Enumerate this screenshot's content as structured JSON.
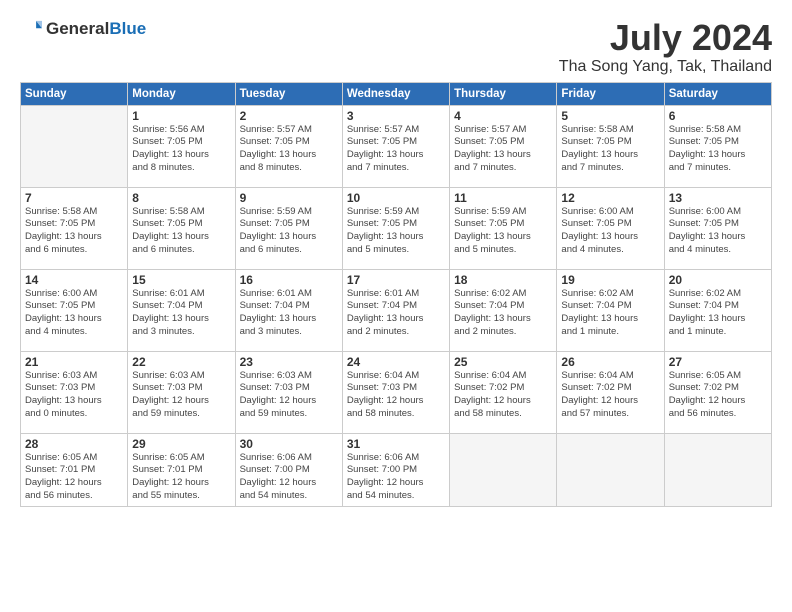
{
  "header": {
    "logo_general": "General",
    "logo_blue": "Blue",
    "month": "July 2024",
    "location": "Tha Song Yang, Tak, Thailand"
  },
  "weekdays": [
    "Sunday",
    "Monday",
    "Tuesday",
    "Wednesday",
    "Thursday",
    "Friday",
    "Saturday"
  ],
  "weeks": [
    [
      {
        "day": "",
        "info": ""
      },
      {
        "day": "1",
        "info": "Sunrise: 5:56 AM\nSunset: 7:05 PM\nDaylight: 13 hours\nand 8 minutes."
      },
      {
        "day": "2",
        "info": "Sunrise: 5:57 AM\nSunset: 7:05 PM\nDaylight: 13 hours\nand 8 minutes."
      },
      {
        "day": "3",
        "info": "Sunrise: 5:57 AM\nSunset: 7:05 PM\nDaylight: 13 hours\nand 7 minutes."
      },
      {
        "day": "4",
        "info": "Sunrise: 5:57 AM\nSunset: 7:05 PM\nDaylight: 13 hours\nand 7 minutes."
      },
      {
        "day": "5",
        "info": "Sunrise: 5:58 AM\nSunset: 7:05 PM\nDaylight: 13 hours\nand 7 minutes."
      },
      {
        "day": "6",
        "info": "Sunrise: 5:58 AM\nSunset: 7:05 PM\nDaylight: 13 hours\nand 7 minutes."
      }
    ],
    [
      {
        "day": "7",
        "info": "Sunrise: 5:58 AM\nSunset: 7:05 PM\nDaylight: 13 hours\nand 6 minutes."
      },
      {
        "day": "8",
        "info": "Sunrise: 5:58 AM\nSunset: 7:05 PM\nDaylight: 13 hours\nand 6 minutes."
      },
      {
        "day": "9",
        "info": "Sunrise: 5:59 AM\nSunset: 7:05 PM\nDaylight: 13 hours\nand 6 minutes."
      },
      {
        "day": "10",
        "info": "Sunrise: 5:59 AM\nSunset: 7:05 PM\nDaylight: 13 hours\nand 5 minutes."
      },
      {
        "day": "11",
        "info": "Sunrise: 5:59 AM\nSunset: 7:05 PM\nDaylight: 13 hours\nand 5 minutes."
      },
      {
        "day": "12",
        "info": "Sunrise: 6:00 AM\nSunset: 7:05 PM\nDaylight: 13 hours\nand 4 minutes."
      },
      {
        "day": "13",
        "info": "Sunrise: 6:00 AM\nSunset: 7:05 PM\nDaylight: 13 hours\nand 4 minutes."
      }
    ],
    [
      {
        "day": "14",
        "info": "Sunrise: 6:00 AM\nSunset: 7:05 PM\nDaylight: 13 hours\nand 4 minutes."
      },
      {
        "day": "15",
        "info": "Sunrise: 6:01 AM\nSunset: 7:04 PM\nDaylight: 13 hours\nand 3 minutes."
      },
      {
        "day": "16",
        "info": "Sunrise: 6:01 AM\nSunset: 7:04 PM\nDaylight: 13 hours\nand 3 minutes."
      },
      {
        "day": "17",
        "info": "Sunrise: 6:01 AM\nSunset: 7:04 PM\nDaylight: 13 hours\nand 2 minutes."
      },
      {
        "day": "18",
        "info": "Sunrise: 6:02 AM\nSunset: 7:04 PM\nDaylight: 13 hours\nand 2 minutes."
      },
      {
        "day": "19",
        "info": "Sunrise: 6:02 AM\nSunset: 7:04 PM\nDaylight: 13 hours\nand 1 minute."
      },
      {
        "day": "20",
        "info": "Sunrise: 6:02 AM\nSunset: 7:04 PM\nDaylight: 13 hours\nand 1 minute."
      }
    ],
    [
      {
        "day": "21",
        "info": "Sunrise: 6:03 AM\nSunset: 7:03 PM\nDaylight: 13 hours\nand 0 minutes."
      },
      {
        "day": "22",
        "info": "Sunrise: 6:03 AM\nSunset: 7:03 PM\nDaylight: 12 hours\nand 59 minutes."
      },
      {
        "day": "23",
        "info": "Sunrise: 6:03 AM\nSunset: 7:03 PM\nDaylight: 12 hours\nand 59 minutes."
      },
      {
        "day": "24",
        "info": "Sunrise: 6:04 AM\nSunset: 7:03 PM\nDaylight: 12 hours\nand 58 minutes."
      },
      {
        "day": "25",
        "info": "Sunrise: 6:04 AM\nSunset: 7:02 PM\nDaylight: 12 hours\nand 58 minutes."
      },
      {
        "day": "26",
        "info": "Sunrise: 6:04 AM\nSunset: 7:02 PM\nDaylight: 12 hours\nand 57 minutes."
      },
      {
        "day": "27",
        "info": "Sunrise: 6:05 AM\nSunset: 7:02 PM\nDaylight: 12 hours\nand 56 minutes."
      }
    ],
    [
      {
        "day": "28",
        "info": "Sunrise: 6:05 AM\nSunset: 7:01 PM\nDaylight: 12 hours\nand 56 minutes."
      },
      {
        "day": "29",
        "info": "Sunrise: 6:05 AM\nSunset: 7:01 PM\nDaylight: 12 hours\nand 55 minutes."
      },
      {
        "day": "30",
        "info": "Sunrise: 6:06 AM\nSunset: 7:00 PM\nDaylight: 12 hours\nand 54 minutes."
      },
      {
        "day": "31",
        "info": "Sunrise: 6:06 AM\nSunset: 7:00 PM\nDaylight: 12 hours\nand 54 minutes."
      },
      {
        "day": "",
        "info": ""
      },
      {
        "day": "",
        "info": ""
      },
      {
        "day": "",
        "info": ""
      }
    ]
  ]
}
